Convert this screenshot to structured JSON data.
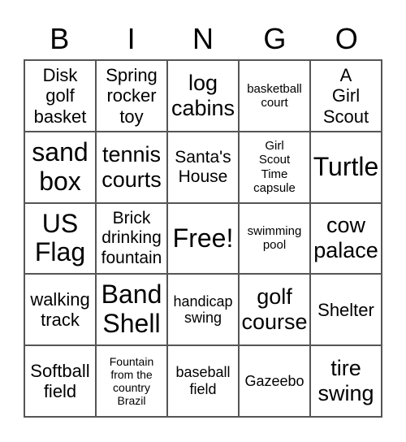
{
  "card": {
    "header": [
      "B",
      "I",
      "N",
      "G",
      "O"
    ],
    "rows": [
      [
        {
          "text": "Disk\ngolf\nbasket",
          "size": "m"
        },
        {
          "text": "Spring\nrocker\ntoy",
          "size": "m"
        },
        {
          "text": "log\ncabins",
          "size": "l"
        },
        {
          "text": "basketball\ncourt",
          "size": "xs"
        },
        {
          "text": "A\nGirl\nScout",
          "size": "m"
        }
      ],
      [
        {
          "text": "sand\nbox",
          "size": "xl"
        },
        {
          "text": "tennis\ncourts",
          "size": "l"
        },
        {
          "text": "Santa's\nHouse",
          "size": "ml"
        },
        {
          "text": "Girl\nScout\nTime\ncapsule",
          "size": "xs"
        },
        {
          "text": "Turtle",
          "size": "xl"
        }
      ],
      [
        {
          "text": "US\nFlag",
          "size": "xl"
        },
        {
          "text": "Brick\ndrinking\nfountain",
          "size": "ml"
        },
        {
          "text": "Free!",
          "size": "xl"
        },
        {
          "text": "swimming\npool",
          "size": "xs"
        },
        {
          "text": "cow\npalace",
          "size": "l"
        }
      ],
      [
        {
          "text": "walking\ntrack",
          "size": "m"
        },
        {
          "text": "Band\nShell",
          "size": "xl"
        },
        {
          "text": "handicap\nswing",
          "size": "s"
        },
        {
          "text": "golf\ncourse",
          "size": "l"
        },
        {
          "text": "Shelter",
          "size": "m"
        }
      ],
      [
        {
          "text": "Softball\nfield",
          "size": "m"
        },
        {
          "text": "Fountain\nfrom the\ncountry\nBrazil",
          "size": "xxs"
        },
        {
          "text": "baseball\nfield",
          "size": "s"
        },
        {
          "text": "Gazeebo",
          "size": "s"
        },
        {
          "text": "tire\nswing",
          "size": "l"
        }
      ]
    ]
  }
}
